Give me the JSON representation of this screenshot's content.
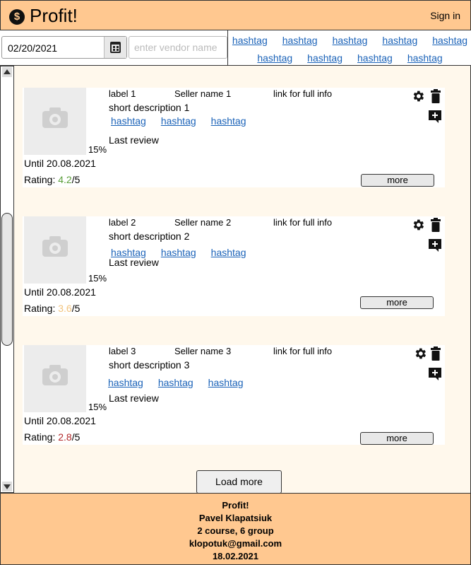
{
  "header": {
    "logo_glyph": "$",
    "title": "Profit!",
    "signin": "Sign in"
  },
  "filters": {
    "date_value": "02/20/2021",
    "vendor_placeholder": "enter vendor name",
    "hashtags_row1": [
      "hashtag",
      "hashtag",
      "hashtag",
      "hashtag",
      "hashtag"
    ],
    "hashtags_row2": [
      "hashtag",
      "hashtag",
      "hashtag",
      "hashtag"
    ]
  },
  "rating_colors": {
    "high": "#5a9e3a",
    "mid": "#f3c47e",
    "low": "#b2282a"
  },
  "cards": [
    {
      "label": "label 1",
      "seller": "Seller name 1",
      "link": "link for full info",
      "description": "short description 1",
      "tags": [
        "hashtag",
        "hashtag",
        "hashtag"
      ],
      "review": "Last review",
      "discount": "15%",
      "until": "Until 20.08.2021",
      "rating_prefix": "Rating: ",
      "rating_value": "4.2",
      "rating_suffix": "/5",
      "rating_color": "#5a9e3a",
      "more": "more"
    },
    {
      "label": "label 2",
      "seller": "Seller name 2",
      "link": "link for full info",
      "description": "short description 2",
      "tags": [
        "hashtag",
        "hashtag",
        "hashtag"
      ],
      "review": "Last review",
      "discount": "15%",
      "until": "Until 20.08.2021",
      "rating_prefix": "Rating: ",
      "rating_value": "3.6",
      "rating_suffix": "/5",
      "rating_color": "#f3c47e",
      "more": "more"
    },
    {
      "label": "label 3",
      "seller": "Seller name 3",
      "link": "link for full info",
      "description": "short description 3",
      "tags": [
        "hashtag",
        "hashtag",
        "hashtag"
      ],
      "review": "Last review",
      "discount": "15%",
      "until": "Until 20.08.2021",
      "rating_prefix": "Rating: ",
      "rating_value": "2.8",
      "rating_suffix": "/5",
      "rating_color": "#b2282a",
      "more": "more"
    }
  ],
  "load_more": "Load more",
  "footer": {
    "line1": "Profit!",
    "line2": "Pavel Klapatsiuk",
    "line3": "2 course, 6 group",
    "line4": "klopotuk@gmail.com",
    "line5": "18.02.2021"
  }
}
